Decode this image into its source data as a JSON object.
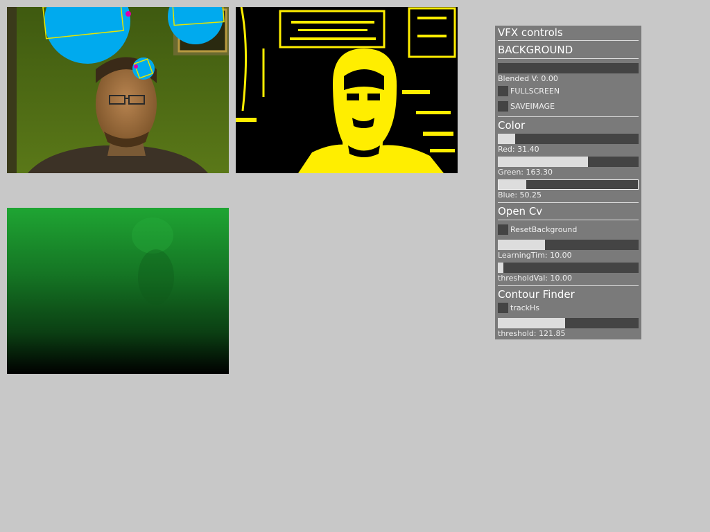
{
  "panel": {
    "title": "VFX controls",
    "groups": {
      "background": {
        "header": "BACKGROUND",
        "blended_label": "Blended V: 0.00",
        "blended_value": 0.0,
        "fullscreen_label": "FULLSCREEN",
        "saveimage_label": "SAVEIMAGE"
      },
      "color": {
        "header": "Color",
        "red_label": "Red: 31.40",
        "red_value": 31.4,
        "green_label": "Green: 163.30",
        "green_value": 163.3,
        "blue_label": "Blue: 50.25",
        "blue_value": 50.25
      },
      "opencv": {
        "header": "Open Cv",
        "reset_label": "ResetBackground",
        "learning_label": "LearningTim: 10.00",
        "learning_value": 10.0,
        "threshold_label": "thresholdVal: 10.00",
        "threshold_value": 10.0
      },
      "contour": {
        "header": "Contour Finder",
        "trackhs_label": "trackHs",
        "threshold_label": "threshold: 121.85",
        "threshold_value": 121.85
      }
    }
  },
  "colors": {
    "background": "#c8c8c8",
    "panel": "#7a7a7a",
    "slider_track": "#444444",
    "slider_fill": "#dddddd",
    "threshold_fg": "#ffee00",
    "blob": "#00aaee",
    "contour": "#e6e600",
    "webcam_green": "#4a6a12",
    "background_green": "#1fa533"
  }
}
